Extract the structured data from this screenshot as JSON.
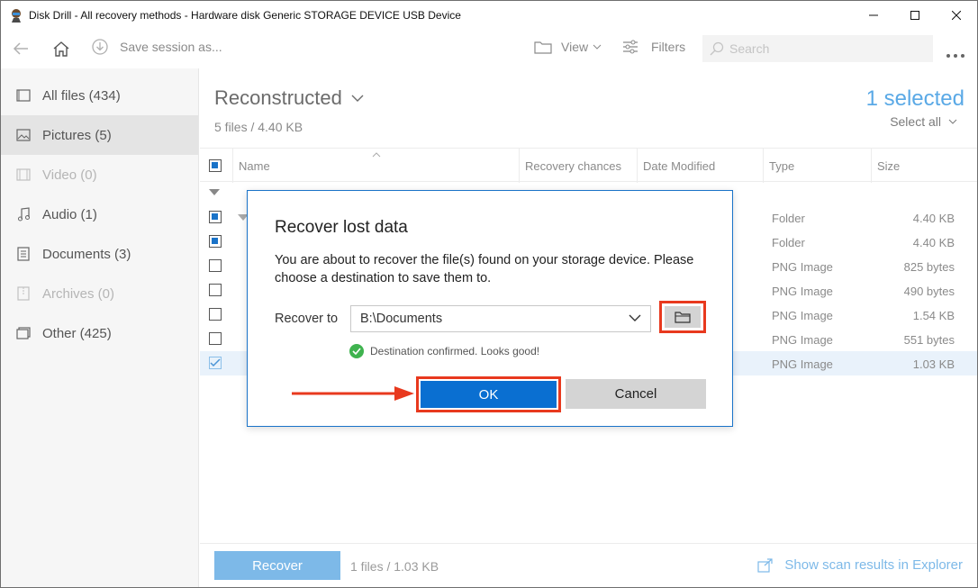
{
  "window": {
    "title": "Disk Drill - All recovery methods - Hardware disk Generic STORAGE DEVICE USB Device"
  },
  "toolbar": {
    "back_icon": "back-arrow-icon",
    "home_icon": "home-icon",
    "save_session_label": "Save session as...",
    "view_label": "View",
    "filters_label": "Filters",
    "search_placeholder": "Search"
  },
  "sidebar": {
    "items": [
      {
        "label": "All files (434)",
        "icon": "all-files-icon"
      },
      {
        "label": "Pictures (5)",
        "icon": "pictures-icon"
      },
      {
        "label": "Video (0)",
        "icon": "video-icon"
      },
      {
        "label": "Audio (1)",
        "icon": "audio-icon"
      },
      {
        "label": "Documents (3)",
        "icon": "documents-icon"
      },
      {
        "label": "Archives (0)",
        "icon": "archives-icon"
      },
      {
        "label": "Other (425)",
        "icon": "other-icon"
      }
    ]
  },
  "main": {
    "heading": "Reconstructed",
    "subheading": "5 files / 4.40 KB",
    "selected_count": "1 selected",
    "select_all_label": "Select all",
    "columns": [
      "Name",
      "Recovery chances",
      "Date Modified",
      "Type",
      "Size"
    ],
    "rows": [
      {
        "type": "Folder",
        "size": "4.40 KB",
        "checked": true
      },
      {
        "type": "Folder",
        "size": "4.40 KB",
        "checked": true
      },
      {
        "type": "PNG Image",
        "size": "825 bytes",
        "checked": false
      },
      {
        "type": "PNG Image",
        "size": "490 bytes",
        "checked": false
      },
      {
        "type": "PNG Image",
        "size": "1.54 KB",
        "checked": false
      },
      {
        "type": "PNG Image",
        "size": "551 bytes",
        "checked": false
      },
      {
        "type": "PNG Image",
        "size": "1.03 KB",
        "checked": true
      }
    ]
  },
  "bottom": {
    "recover_label": "Recover",
    "info": "1 files / 1.03 KB",
    "show_explorer_label": "Show scan results in Explorer"
  },
  "dialog": {
    "title": "Recover lost data",
    "message": "You are about to recover the file(s) found on your storage device. Please choose a destination to save them to.",
    "recover_to_label": "Recover to",
    "destination": "B:\\Documents",
    "confirm_text": "Destination confirmed. Looks good!",
    "ok_label": "OK",
    "cancel_label": "Cancel"
  },
  "colors": {
    "accent": "#0a6fd1",
    "highlight": "#e8391e",
    "success": "#3fb34f",
    "light_blue": "#7db9e8"
  }
}
